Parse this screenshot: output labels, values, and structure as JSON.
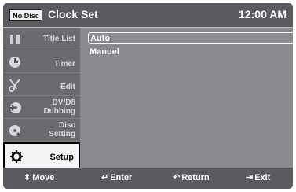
{
  "header": {
    "no_disc_label": "No Disc",
    "title": "Clock Set",
    "clock": "12:00 AM"
  },
  "sidebar": {
    "items": [
      {
        "label": "Title List",
        "icon": "title-list-icon"
      },
      {
        "label": "Timer",
        "icon": "timer-icon"
      },
      {
        "label": "Edit",
        "icon": "scissors-icon"
      },
      {
        "label_line1": "DV/D8",
        "label_line2": "Dubbing",
        "icon": "dubbing-icon"
      },
      {
        "label_line1": "Disc",
        "label_line2": "Setting",
        "icon": "disc-setting-icon"
      },
      {
        "label": "Setup",
        "icon": "gear-icon"
      }
    ],
    "active_index": 5
  },
  "options": {
    "items": [
      "Auto",
      "Manuel"
    ],
    "selected_index": 0
  },
  "footer": {
    "move_icon": "updown-arrow-icon",
    "move_label": "Move",
    "enter_icon": "enter-icon",
    "enter_label": "Enter",
    "return_icon": "return-icon",
    "return_label": "Return",
    "exit_icon": "exit-icon",
    "exit_label": "Exit"
  },
  "colors": {
    "panel": "#7d7c83",
    "header": "#5b5a61",
    "sidebar": "#6b6a71",
    "content": "#8a8990",
    "active": "#f5f5f5"
  }
}
